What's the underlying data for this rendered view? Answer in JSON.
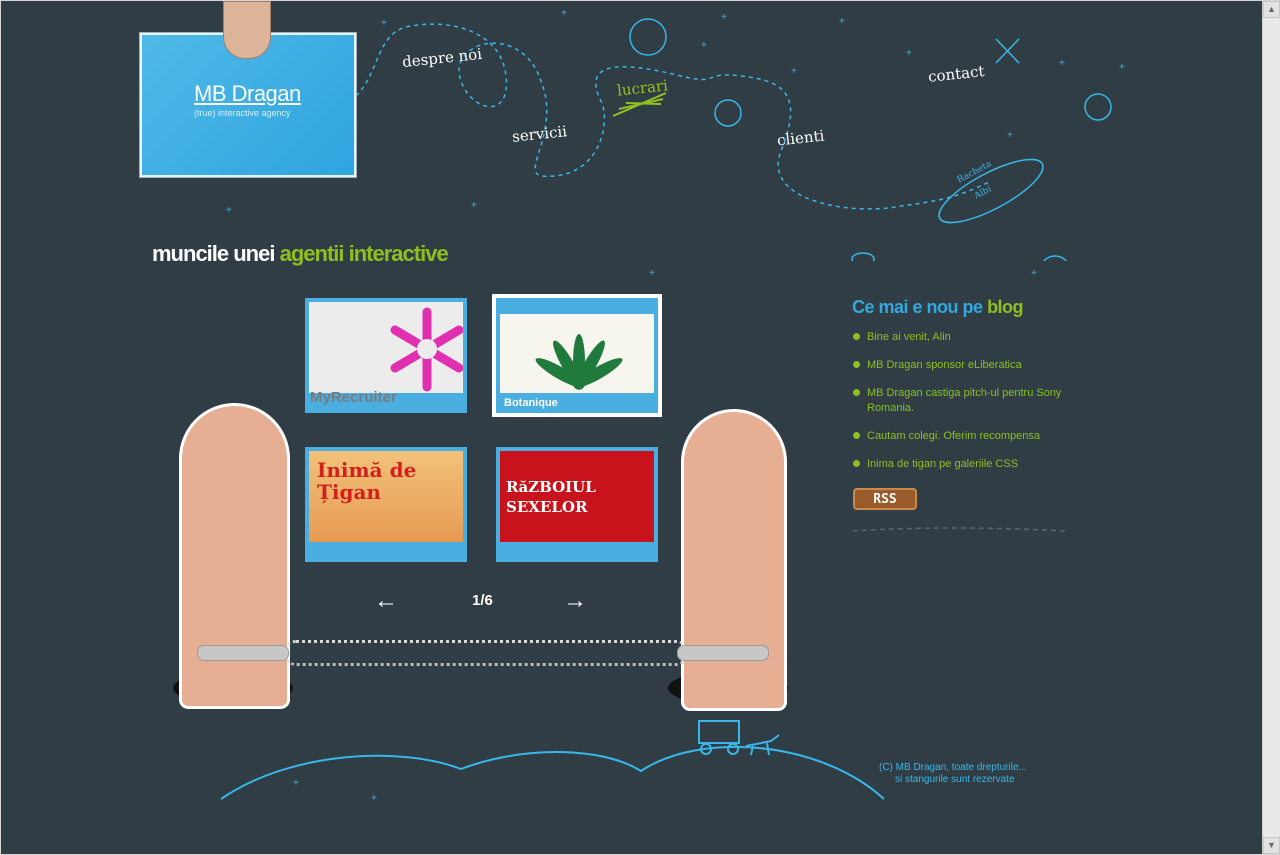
{
  "site": {
    "brand": "MB Dragan",
    "tagline": "(true) interactive agency"
  },
  "nav": {
    "despre": "despre noi",
    "lucrari": "lucrari",
    "servicii": "servicii",
    "clienti": "clienti",
    "contact": "contact"
  },
  "main": {
    "heading_part1": "muncile unei",
    "heading_part2": "agentii interactive",
    "portfolio": [
      {
        "label": "MyRecruiter"
      },
      {
        "label": "Botanique"
      },
      {
        "label": "Inimă de Țigan"
      },
      {
        "label": "RăZBOIUL SEXELOR"
      }
    ],
    "pager": "1/6",
    "active_label": "Botanique"
  },
  "blog": {
    "title_part1": "Ce mai e nou pe",
    "title_part2": "blog",
    "posts": [
      "Bine ai venit, Alin",
      "MB Dragan sponsor eLiberatica",
      "MB Dragan castiga pitch-ul pentru Sony Romania.",
      "Cautam colegi. Oferim recompensa",
      "Inima de tigan pe galeriile CSS"
    ],
    "rss_label": "RSS"
  },
  "footer": {
    "copyright_line1": "(C) MB Dragan, toate drepturile...",
    "copyright_line2": "si stangurile sunt rezervate"
  },
  "doodles": {
    "rocket_line1": "Racheta",
    "rocket_line2": "Albi"
  },
  "colors": {
    "background": "#303d45",
    "accent_blue": "#38b6e9",
    "accent_green": "#8fbe1f"
  }
}
